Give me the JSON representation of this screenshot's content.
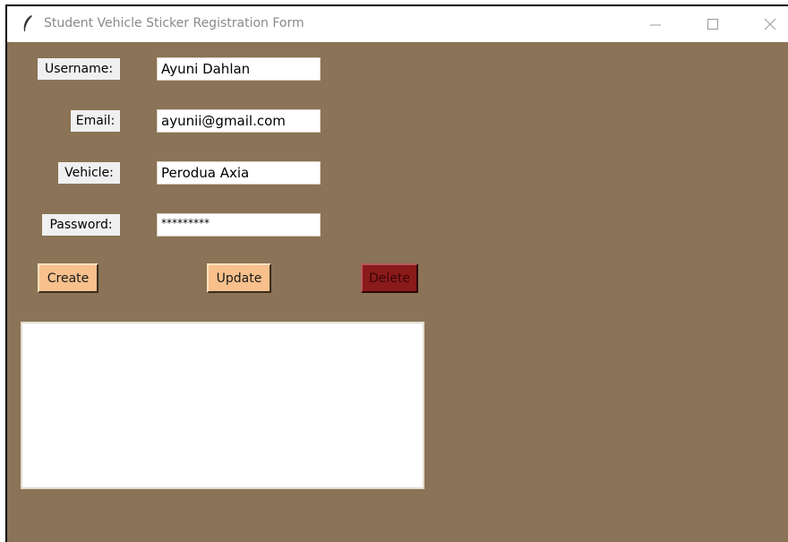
{
  "window": {
    "title": "Student Vehicle Sticker Registration Form",
    "minimize_icon": "minimize-icon",
    "maximize_icon": "maximize-icon",
    "close_icon": "close-icon",
    "app_icon": "feather-icon"
  },
  "form": {
    "username_label": "Username:",
    "username_value": "Ayuni Dahlan",
    "email_label": "Email:",
    "email_value": "ayunii@gmail.com",
    "vehicle_label": "Vehicle:",
    "vehicle_value": "Perodua Axia",
    "password_label": "Password:",
    "password_value": "*********"
  },
  "buttons": {
    "create_label": "Create",
    "update_label": "Update",
    "delete_label": "Delete"
  },
  "colors": {
    "background": "#8a7356",
    "button_light": "#f7c08c",
    "button_delete": "#8b1a1a"
  }
}
